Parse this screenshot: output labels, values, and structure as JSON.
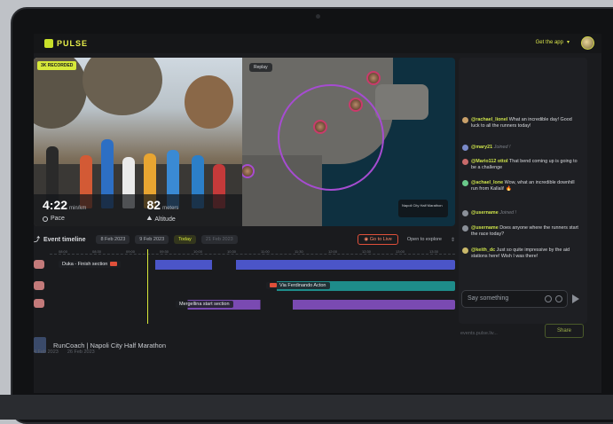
{
  "app": {
    "name": "PULSE",
    "get_app_label": "Get the app"
  },
  "video": {
    "badge": "3K RECORDED",
    "pace_value": "4:22",
    "pace_unit": "min/km",
    "pace_label": "Pace",
    "altitude_value": "82",
    "altitude_unit": "meters",
    "altitude_label": "Altitude"
  },
  "map": {
    "replay_label": "Replay",
    "card_text": "Napoli City Half Marathon"
  },
  "chat": {
    "messages": [
      {
        "user": "@rachael_lionel",
        "text": "What an incredible day! Good luck to all the runners today!"
      },
      {
        "user": "@mary21",
        "text": "",
        "meta": "Joined !"
      },
      {
        "user": "@Mario112 ottoI",
        "text": "That bend coming up is going to be a challenge"
      },
      {
        "user": "@achael_lone",
        "text": "Wow, what an incredible downhill run from Kallali! 🔥"
      },
      {
        "user": "@username",
        "text": "",
        "meta": "Joined !"
      },
      {
        "user": "@username",
        "text": "Does anyone where the runners start the race today?"
      },
      {
        "user": "@keith_dc",
        "text": "Just so quite impressive by the aid stations here! Wish I was there!"
      }
    ],
    "input_placeholder": "Say something"
  },
  "timeline": {
    "title": "Event timeline",
    "dates": [
      "8 Feb 2023",
      "9 Feb 2023",
      "Today",
      "21 Feb 2023"
    ],
    "go_live_label": "Go to Live",
    "explore_label": "Open to explore",
    "tracks": [
      {
        "label": "Duka - Finish section"
      },
      {
        "label": "Via Ferdinando Acton"
      },
      {
        "label": "Mergellina start section"
      }
    ],
    "ticks": [
      "08:00",
      "08:30",
      "09:00",
      "09:30",
      "10:00",
      "10:30",
      "11:00",
      "11:30",
      "12:00",
      "12:30",
      "13:00",
      "13:30"
    ]
  },
  "event": {
    "title": "RunCoach | Napoli City Half Marathon",
    "date_start": "4 Feb 2023",
    "date_end": "26 Feb 2023",
    "share_placeholder": "events.pulse.liv...",
    "share_label": "Share"
  },
  "colors": {
    "accent": "#d7e93a",
    "track_blue": "#4b55c8",
    "track_teal": "#1e8c8a",
    "track_purple": "#7a4ab2",
    "live_red": "#e0503a"
  }
}
